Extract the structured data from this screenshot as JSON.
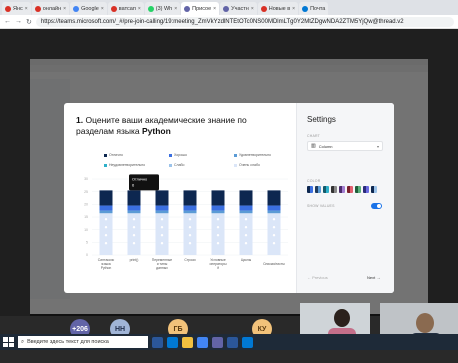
{
  "browser": {
    "tabs": [
      {
        "label": "Янс"
      },
      {
        "label": "онлайн"
      },
      {
        "label": "Google"
      },
      {
        "label": "ватсап"
      },
      {
        "label": "(3) Wh"
      },
      {
        "label": "Присое"
      },
      {
        "label": "Участн"
      },
      {
        "label": "Новые в"
      },
      {
        "label": "Почта"
      }
    ],
    "url": "https://teams.microsoft.com/_#/pre-join-calling/19:meeting_ZmVkYzdlNTEtOTc0NS00MDlmLTg0Y2MtZDgwNDA2ZTM5YjQw@thread.v2"
  },
  "modal": {
    "question_number": "1.",
    "question_text": "Оцените ваши академические знание по разделам языка",
    "question_bold": "Python",
    "tooltip_label": "Отлично",
    "tooltip_value": "6",
    "settings_title": "Settings",
    "chart_label": "CHART",
    "chart_select": "Column",
    "color_label": "COLOR",
    "show_values_label": "SHOW VALUES",
    "prev_label": "Previous",
    "next_label": "Next"
  },
  "colors": {
    "navy": "#0d2750",
    "blue": "#3b6fe0",
    "sky": "#5b9bd5",
    "teal": "#2fb0c9",
    "pale": "#dbe6f8",
    "toggle": "#1a73e8"
  },
  "chart_data": {
    "type": "bar",
    "stacked": true,
    "legend": [
      "Отлично",
      "Хорошо",
      "Удовлетворительно",
      "Неудовлетворительно",
      "Слабо",
      "Очень слабо"
    ],
    "categories": [
      "Синтаксис языка Python",
      "print()",
      "Переменные и типы данных",
      "Строки",
      "Условные операторы if",
      "Циклы",
      "Списки/листы"
    ],
    "series": [
      {
        "name": "Отлично",
        "values": [
          6,
          6,
          6,
          6,
          6,
          6,
          6
        ]
      },
      {
        "name": "Хорошо",
        "values": [
          2,
          2,
          2,
          2,
          2,
          2,
          2
        ]
      },
      {
        "name": "Удовлетворительно",
        "values": [
          1,
          1,
          1,
          1,
          1,
          1,
          1
        ]
      }
    ],
    "y_ticks": [
      "0",
      "5",
      "10",
      "15",
      "20",
      "25",
      "30"
    ],
    "ylim": [
      0,
      30
    ]
  },
  "meeting": {
    "participants": [
      {
        "initials": "+206",
        "color": "#6264a7"
      },
      {
        "initials": "НН",
        "color": "#a0b4d6"
      },
      {
        "initials": "ГБ",
        "color": "#f2c27a"
      },
      {
        "initials": "КУ",
        "color": "#f2c27a"
      }
    ]
  },
  "taskbar": {
    "search_placeholder": "Введите здесь текст для поиска"
  }
}
